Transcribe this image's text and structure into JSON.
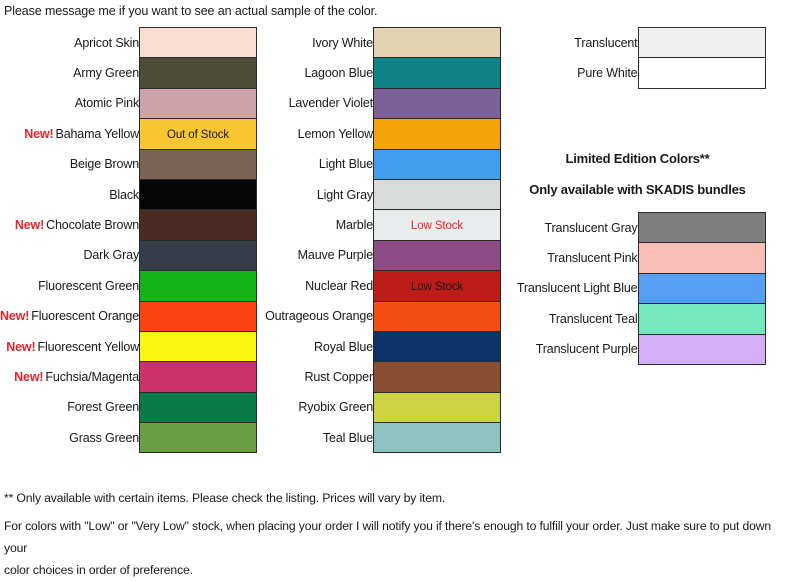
{
  "top_note": "Please message me if you want to see an actual sample of the color.",
  "columns": {
    "main_1": {
      "name": "standard-colors-column-1",
      "rows": [
        {
          "label": "Apricot Skin",
          "new": false,
          "color": "#fadfd1",
          "stock": ""
        },
        {
          "label": "Army Green",
          "new": false,
          "color": "#4c4c37",
          "stock": ""
        },
        {
          "label": "Atomic Pink",
          "new": false,
          "color": "#cda2aa",
          "stock": ""
        },
        {
          "label": "Bahama Yellow",
          "new": true,
          "color": "#f8c631",
          "stock": "Out of Stock",
          "stock_style": "dark"
        },
        {
          "label": "Beige Brown",
          "new": false,
          "color": "#7c6455",
          "stock": ""
        },
        {
          "label": "Black",
          "new": false,
          "color": "#050505",
          "stock": ""
        },
        {
          "label": "Chocolate Brown",
          "new": true,
          "color": "#4a2b21",
          "stock": ""
        },
        {
          "label": "Dark Gray",
          "new": false,
          "color": "#363d49",
          "stock": ""
        },
        {
          "label": "Fluorescent Green",
          "new": false,
          "color": "#14b317",
          "stock": ""
        },
        {
          "label": "Fluorescent Orange",
          "new": true,
          "color": "#fa4410",
          "stock": ""
        },
        {
          "label": "Fluorescent Yellow",
          "new": true,
          "color": "#faf613",
          "stock": ""
        },
        {
          "label": "Fuchsia/Magenta",
          "new": true,
          "color": "#cc3169",
          "stock": ""
        },
        {
          "label": "Forest Green",
          "new": false,
          "color": "#0a7a47",
          "stock": ""
        },
        {
          "label": "Grass Green",
          "new": false,
          "color": "#6b9e42",
          "stock": ""
        }
      ]
    },
    "main_2": {
      "name": "standard-colors-column-2",
      "rows": [
        {
          "label": "Ivory White",
          "new": false,
          "color": "#e3d2b4",
          "stock": ""
        },
        {
          "label": "Lagoon Blue",
          "new": false,
          "color": "#0d8386",
          "stock": ""
        },
        {
          "label": "Lavender Violet",
          "new": false,
          "color": "#7c6198",
          "stock": ""
        },
        {
          "label": "Lemon Yellow",
          "new": false,
          "color": "#f5a308",
          "stock": ""
        },
        {
          "label": "Light Blue",
          "new": false,
          "color": "#3f9ef0",
          "stock": ""
        },
        {
          "label": "Light Gray",
          "new": false,
          "color": "#d9dada",
          "stock": ""
        },
        {
          "label": "Marble",
          "new": false,
          "color": "#e8ecec",
          "stock": "Low Stock",
          "stock_style": "red"
        },
        {
          "label": "Mauve Purple",
          "new": false,
          "color": "#8d4b85",
          "stock": ""
        },
        {
          "label": "Nuclear Red",
          "new": false,
          "color": "#bd1b17",
          "stock": "Low Stock",
          "stock_style": "dark"
        },
        {
          "label": "Outrageous Orange",
          "new": false,
          "color": "#f64d11",
          "stock": ""
        },
        {
          "label": "Royal Blue",
          "new": false,
          "color": "#0a3368",
          "stock": ""
        },
        {
          "label": "Rust Copper",
          "new": false,
          "color": "#8a4f32",
          "stock": ""
        },
        {
          "label": "Ryobix Green",
          "new": false,
          "color": "#ccd342",
          "stock": ""
        },
        {
          "label": "Teal Blue",
          "new": false,
          "color": "#8cc2bf",
          "stock": ""
        }
      ]
    },
    "clear": {
      "name": "clear-colors-column",
      "rows": [
        {
          "label": "Translucent",
          "new": false,
          "color": "#f0f0f0",
          "stock": ""
        },
        {
          "label": "Pure White",
          "new": false,
          "color": "#ffffff",
          "stock": ""
        }
      ]
    },
    "limited": {
      "name": "limited-edition-column",
      "heading_1": "Limited Edition Colors**",
      "heading_2": "Only available with SKADIS bundles",
      "rows": [
        {
          "label": "Translucent Gray",
          "new": false,
          "color": "#807f80",
          "stock": ""
        },
        {
          "label": "Translucent Pink",
          "new": false,
          "color": "#f9bdb8",
          "stock": ""
        },
        {
          "label": "Translucent Light Blue",
          "new": false,
          "color": "#55a0f5",
          "stock": ""
        },
        {
          "label": "Translucent Teal",
          "new": false,
          "color": "#73e8bf",
          "stock": ""
        },
        {
          "label": "Translucent Purple",
          "new": false,
          "color": "#d4aff8",
          "stock": ""
        }
      ]
    }
  },
  "footer": {
    "line_1": "** Only available with certain items. Please check the listing. Prices will vary by item.",
    "line_2": "For colors with \"Low\" or \"Very Low\" stock, when placing your order I will notify you if there's enough to fulfill your order. Just make sure to put down your",
    "line_3": "color choices in order of preference."
  },
  "new_flag_text": "New!",
  "accent_colors": {
    "new_flag": "#e8242a",
    "low_stock": "#e8242a",
    "border": "#2b2b2b",
    "text": "#1a1a1a"
  }
}
